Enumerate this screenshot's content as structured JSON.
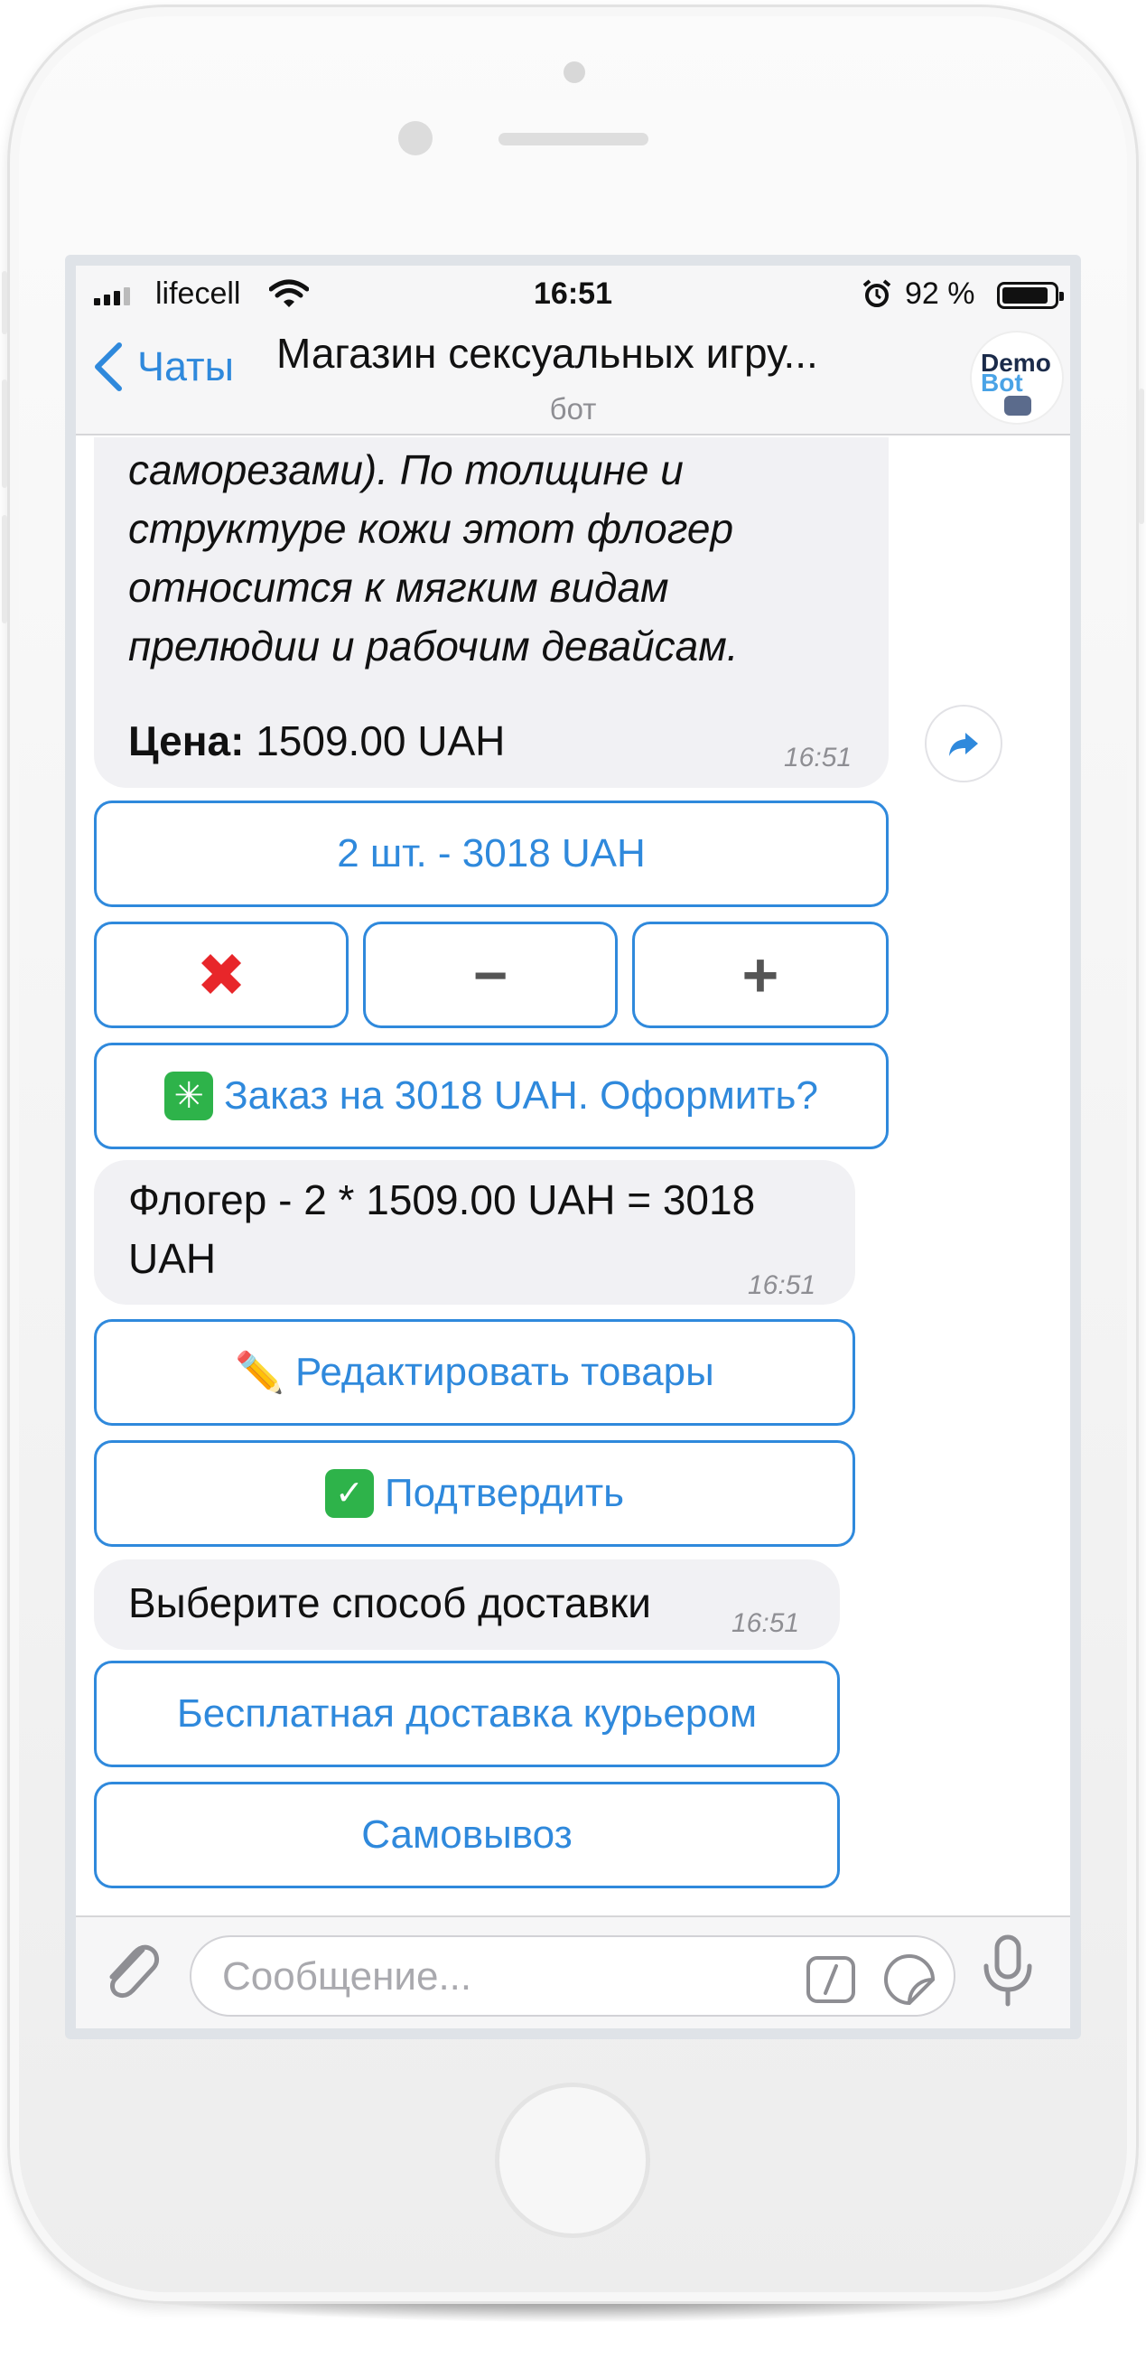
{
  "status_bar": {
    "carrier": "lifecell",
    "time": "16:51",
    "battery_percent": "92 %",
    "battery_level": 0.92,
    "signal_bars": 3
  },
  "header": {
    "back_label": "Чаты",
    "title": "Магазин сексуальных игру...",
    "subtitle": "бот",
    "avatar_line1": "Demo",
    "avatar_line2": "Bot"
  },
  "messages": {
    "product": {
      "lines": [
        "саморезами). По толщине и",
        "структуре кожи этот флогер",
        "относится к мягким видам",
        "прелюдии и рабочим девайсам."
      ],
      "price_label": "Цена:",
      "price_value": " 1509.00 UAH",
      "time": "16:51"
    },
    "product_keyboard": {
      "quantity_button": "2 шт. - 3018 UAH",
      "remove_button": "✖",
      "minus_button": "−",
      "plus_button": "+",
      "order_icon": "✳",
      "order_button": "Заказ на 3018 UAH. Оформить?"
    },
    "summary": {
      "text_line1": "Флогер - 2 * 1509.00 UAH = 3018",
      "text_line2": "UAH",
      "time": "16:51"
    },
    "summary_keyboard": {
      "edit_icon": "✏️",
      "edit_button": "Редактировать товары",
      "confirm_icon": "✅",
      "confirm_button": "Подтвердить"
    },
    "delivery": {
      "text": "Выберите способ доставки",
      "time": "16:51"
    },
    "delivery_keyboard": {
      "courier_button": "Бесплатная доставка курьером",
      "pickup_button": "Самовывоз"
    }
  },
  "input": {
    "placeholder": "Сообщение..."
  },
  "colors": {
    "accent": "#2f89dc",
    "bubble": "#f1f1f4",
    "remove_red": "#e8262a",
    "confirm_green": "#2eb34a"
  },
  "icons": [
    "back-chevron-icon",
    "wifi-icon",
    "alarm-icon",
    "share-icon",
    "paperclip-icon",
    "slash-command-icon",
    "sticker-icon",
    "microphone-icon"
  ]
}
